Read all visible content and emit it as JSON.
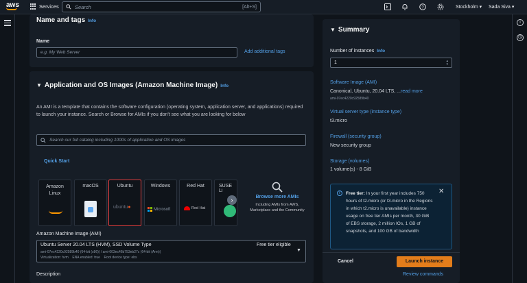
{
  "topbar": {
    "logo": "aws",
    "services_label": "Services",
    "search_placeholder": "Search",
    "search_shortcut": "[Alt+S]",
    "region": "Stockholm ▾",
    "user": "Sada Siva ▾",
    "icons": [
      "cloudshell-icon",
      "bell-icon",
      "help-icon",
      "gear-icon"
    ]
  },
  "name_section": {
    "title": "Name and tags",
    "info": "Info",
    "name_label": "Name",
    "name_placeholder": "e.g. My Web Server",
    "add_tags_link": "Add additional tags"
  },
  "ami_section": {
    "title": "Application and OS Images (Amazon Machine Image)",
    "info": "Info",
    "description": "An AMI is a template that contains the software configuration (operating system, application server, and applications) required to launch your instance. Search or Browse for AMIs if you don't see what you are looking for below",
    "search_placeholder": "Search our full catalog including 1000s of application and OS images",
    "quick_start": "Quick Start",
    "tiles": [
      {
        "label": "Amazon Linux"
      },
      {
        "label": "macOS"
      },
      {
        "label": "Ubuntu",
        "logo_text": "ubuntu"
      },
      {
        "label": "Windows",
        "logo_text": "Microsoft"
      },
      {
        "label": "Red Hat",
        "logo_text": "Red Hat"
      },
      {
        "label": "SUSE Li"
      }
    ],
    "browse_more": "Browse more AMIs",
    "browse_sub": "Including AMIs from AWS, Marketplace and the Community",
    "ami_label": "Amazon Machine Image (AMI)",
    "ami_name": "Ubuntu Server 20.04 LTS (HVM), SSD Volume Type",
    "ami_badge": "Free tier eligible",
    "ami_ids": "ami-07ec4220c92589b40 (64-bit (x86)) / ami-003ec46b753eb27c (64-bit (Arm))",
    "ami_meta": "Virtualization: hvm    ENA enabled: true    Root device type: ebs",
    "description_label": "Description"
  },
  "summary": {
    "title": "Summary",
    "instances_label": "Number of instances",
    "info": "Info",
    "instances_value": "1",
    "image_label": "Software Image (AMI)",
    "image_value": "Canonical, Ubuntu, 20.04 LTS, ...",
    "image_more": "read more",
    "image_id": "ami-07ec4220c92589b40",
    "type_label": "Virtual server type (instance type)",
    "type_value": "t3.micro",
    "firewall_label": "Firewall (security group)",
    "firewall_value": "New security group",
    "storage_label": "Storage (volumes)",
    "storage_value": "1 volume(s) - 8 GiB",
    "free_tier_title": "Free tier:",
    "free_tier_text": "In your first year includes 750 hours of t2.micro (or t3.micro in the Regions in which t2.micro is unavailable) instance usage on free tier AMIs per month, 30 GiB of EBS storage, 2 million IOs, 1 GB of snapshots, and 100 GB of bandwidth",
    "cancel": "Cancel",
    "launch": "Launch instance",
    "review": "Review commands"
  },
  "colors": {
    "accent": "#ff9900",
    "link": "#539fe5",
    "launch": "#e37d1b",
    "highlight": "#e03c3c"
  }
}
